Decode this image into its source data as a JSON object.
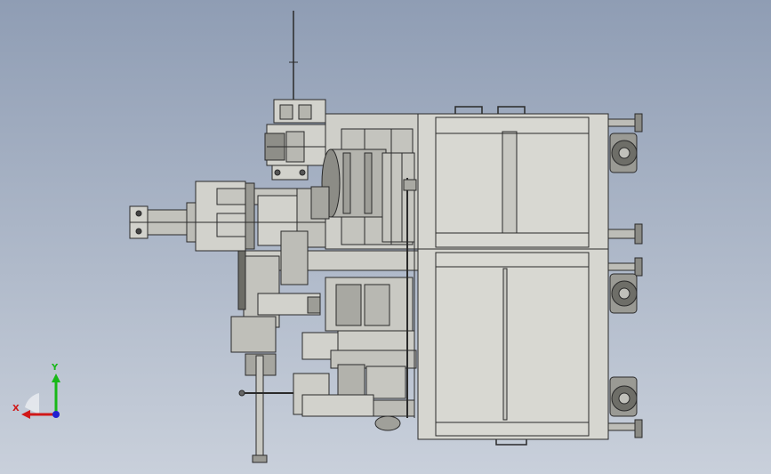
{
  "viewport": {
    "background_top": "#8f9db4",
    "background_bottom": "#c9d0db"
  },
  "model": {
    "part_fill": "#d2d2cc",
    "part_dark": "#9a9a92",
    "edge_color": "#2a2a2a",
    "shade_fill": "#6c6c66"
  },
  "triad": {
    "x_label": "X",
    "y_label": "Y",
    "x_color": "#d01818",
    "y_color": "#18b818",
    "z_color": "#2020d0"
  }
}
